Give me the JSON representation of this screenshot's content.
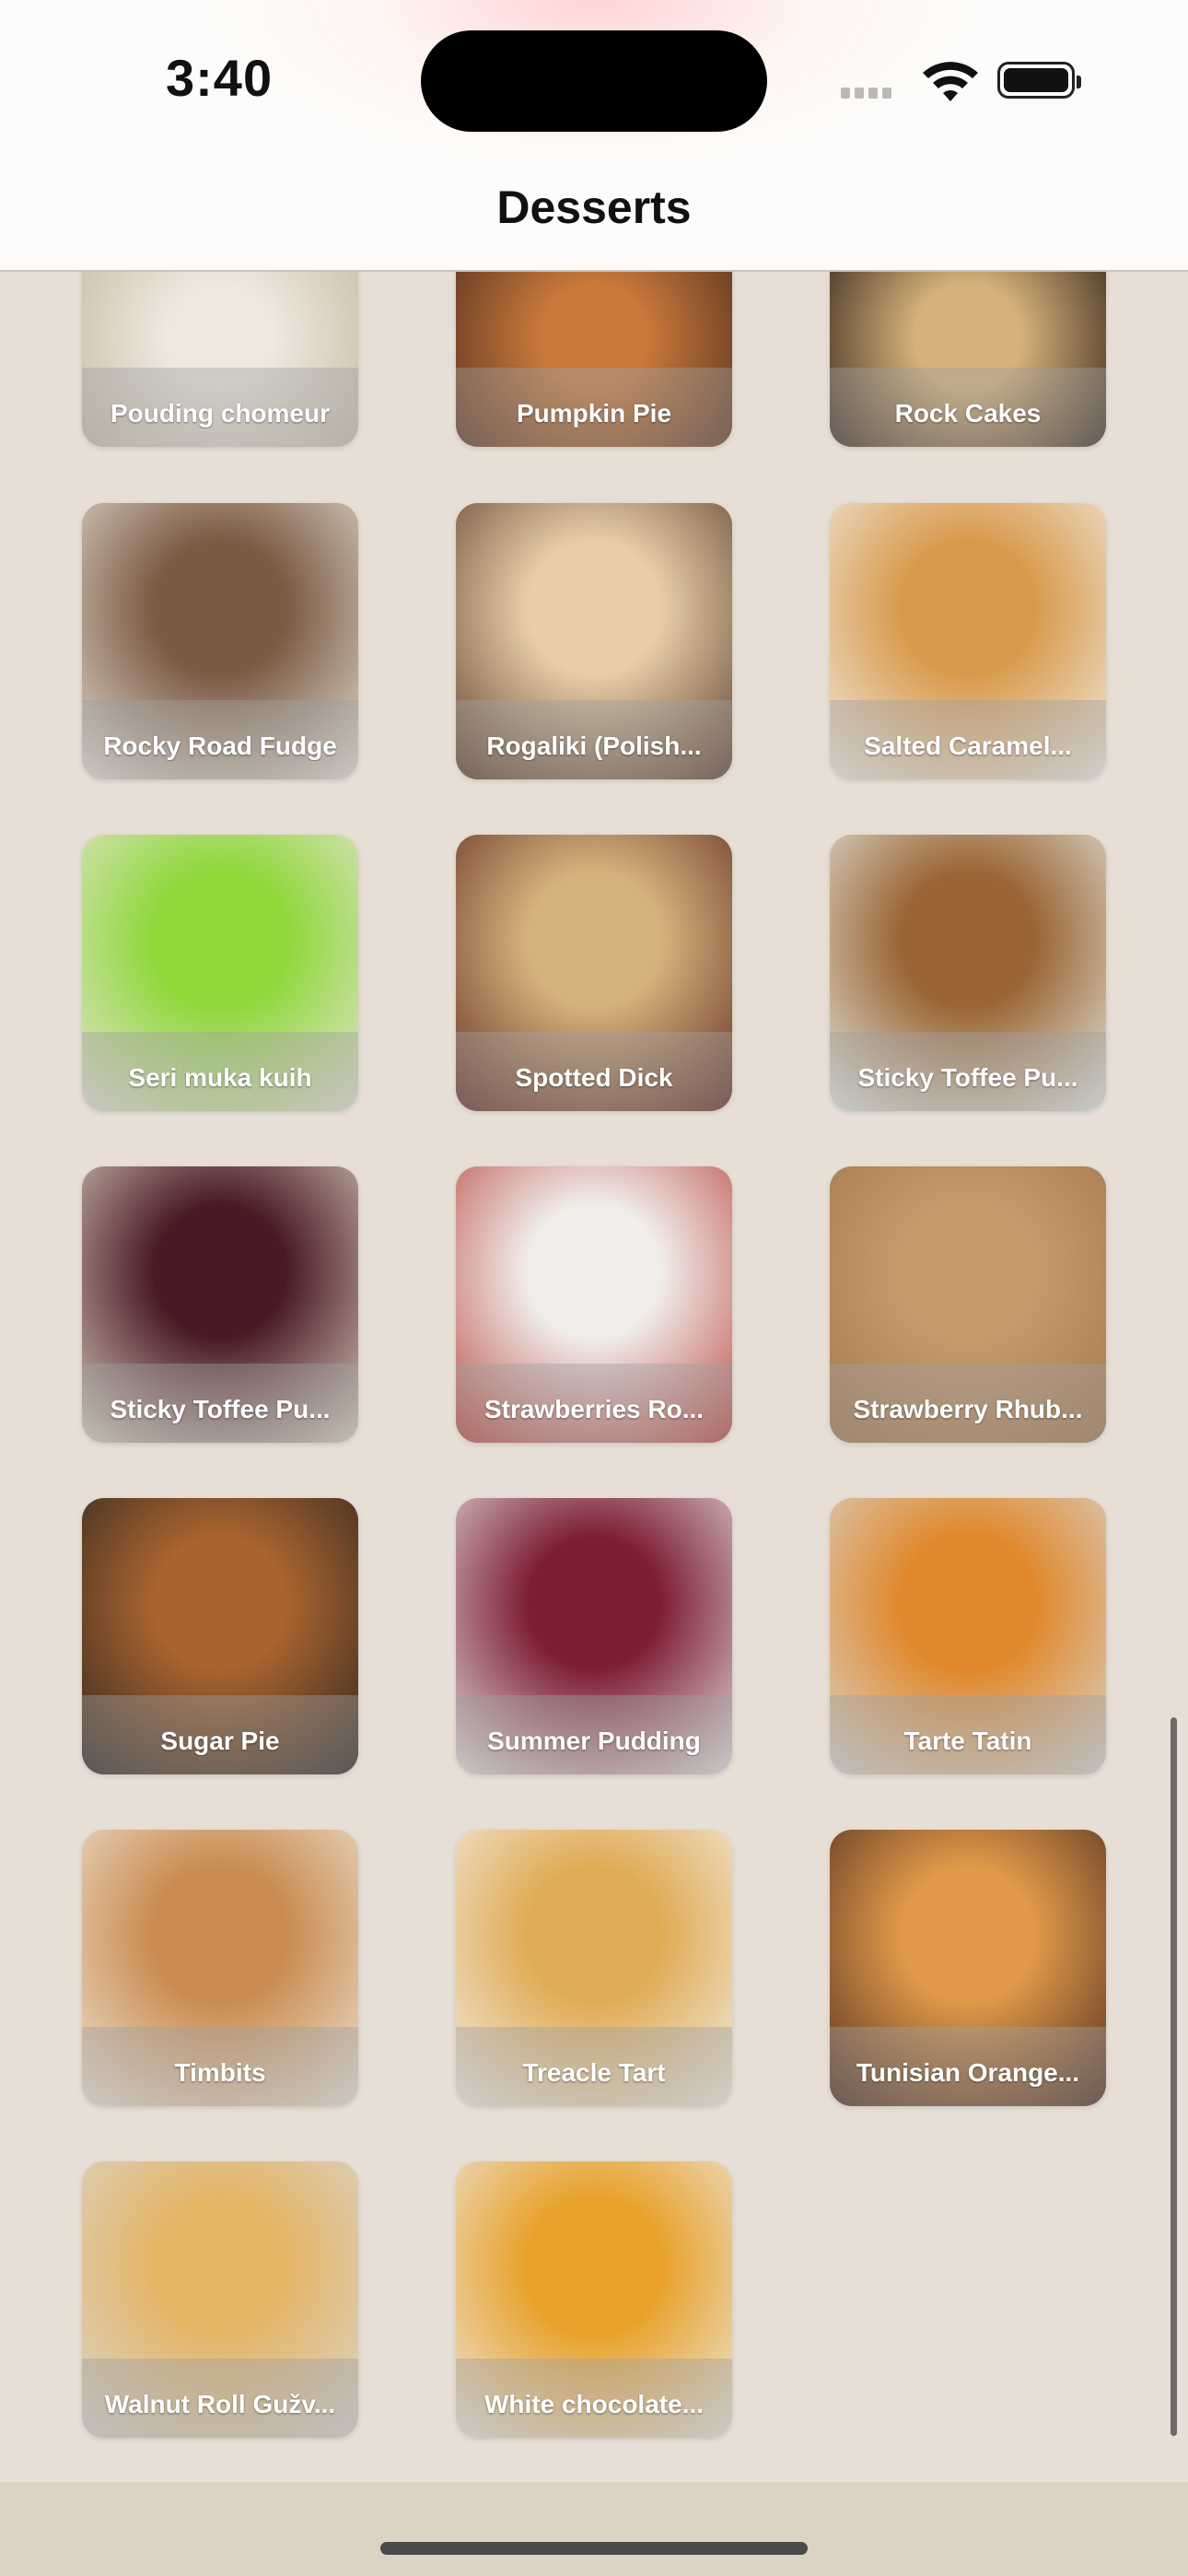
{
  "status_bar": {
    "time": "3:40"
  },
  "nav": {
    "title": "Desserts"
  },
  "desserts": [
    {
      "name": "Pouding chomeur",
      "colors": [
        "#efe8de",
        "#c9bda8"
      ]
    },
    {
      "name": "Pumpkin Pie",
      "colors": [
        "#c9793a",
        "#5b3522"
      ]
    },
    {
      "name": "Rock Cakes",
      "colors": [
        "#d6b27a",
        "#3a2a1f"
      ]
    },
    {
      "name": "Rocky Road Fudge",
      "colors": [
        "#7a5a44",
        "#e9e2d6"
      ]
    },
    {
      "name": "Rogaliki (Polish...",
      "colors": [
        "#e8cfa8",
        "#5a3b2b"
      ]
    },
    {
      "name": "Salted Caramel...",
      "colors": [
        "#d89a4c",
        "#f2eee8"
      ]
    },
    {
      "name": "Seri muka kuih",
      "colors": [
        "#8ed83a",
        "#e9e3d8"
      ]
    },
    {
      "name": "Spotted Dick",
      "colors": [
        "#d7b37c",
        "#5e2a22"
      ]
    },
    {
      "name": "Sticky Toffee Pu...",
      "colors": [
        "#9a6433",
        "#e7ece6"
      ]
    },
    {
      "name": "Sticky Toffee Pu...",
      "colors": [
        "#4a1a24",
        "#ddd3bf"
      ]
    },
    {
      "name": "Strawberries Ro...",
      "colors": [
        "#f1eeea",
        "#b8463f"
      ]
    },
    {
      "name": "Strawberry Rhub...",
      "colors": [
        "#c69b6c",
        "#a0764e"
      ]
    },
    {
      "name": "Sugar Pie",
      "colors": [
        "#a9642f",
        "#2a2420"
      ]
    },
    {
      "name": "Summer Pudding",
      "colors": [
        "#7d1f33",
        "#e7e4e1"
      ]
    },
    {
      "name": "Tarte Tatin",
      "colors": [
        "#e0882b",
        "#d9d7d3"
      ]
    },
    {
      "name": "Timbits",
      "colors": [
        "#c98b4f",
        "#efe6da"
      ]
    },
    {
      "name": "Treacle Tart",
      "colors": [
        "#e0ab55",
        "#f3efe8"
      ]
    },
    {
      "name": "Tunisian Orange...",
      "colors": [
        "#e19a4a",
        "#4a2a1e"
      ]
    },
    {
      "name": "Walnut Roll Gužv...",
      "colors": [
        "#e5b566",
        "#d9d6d1"
      ]
    },
    {
      "name": "White chocolate...",
      "colors": [
        "#e8a129",
        "#ece9e4"
      ]
    }
  ]
}
